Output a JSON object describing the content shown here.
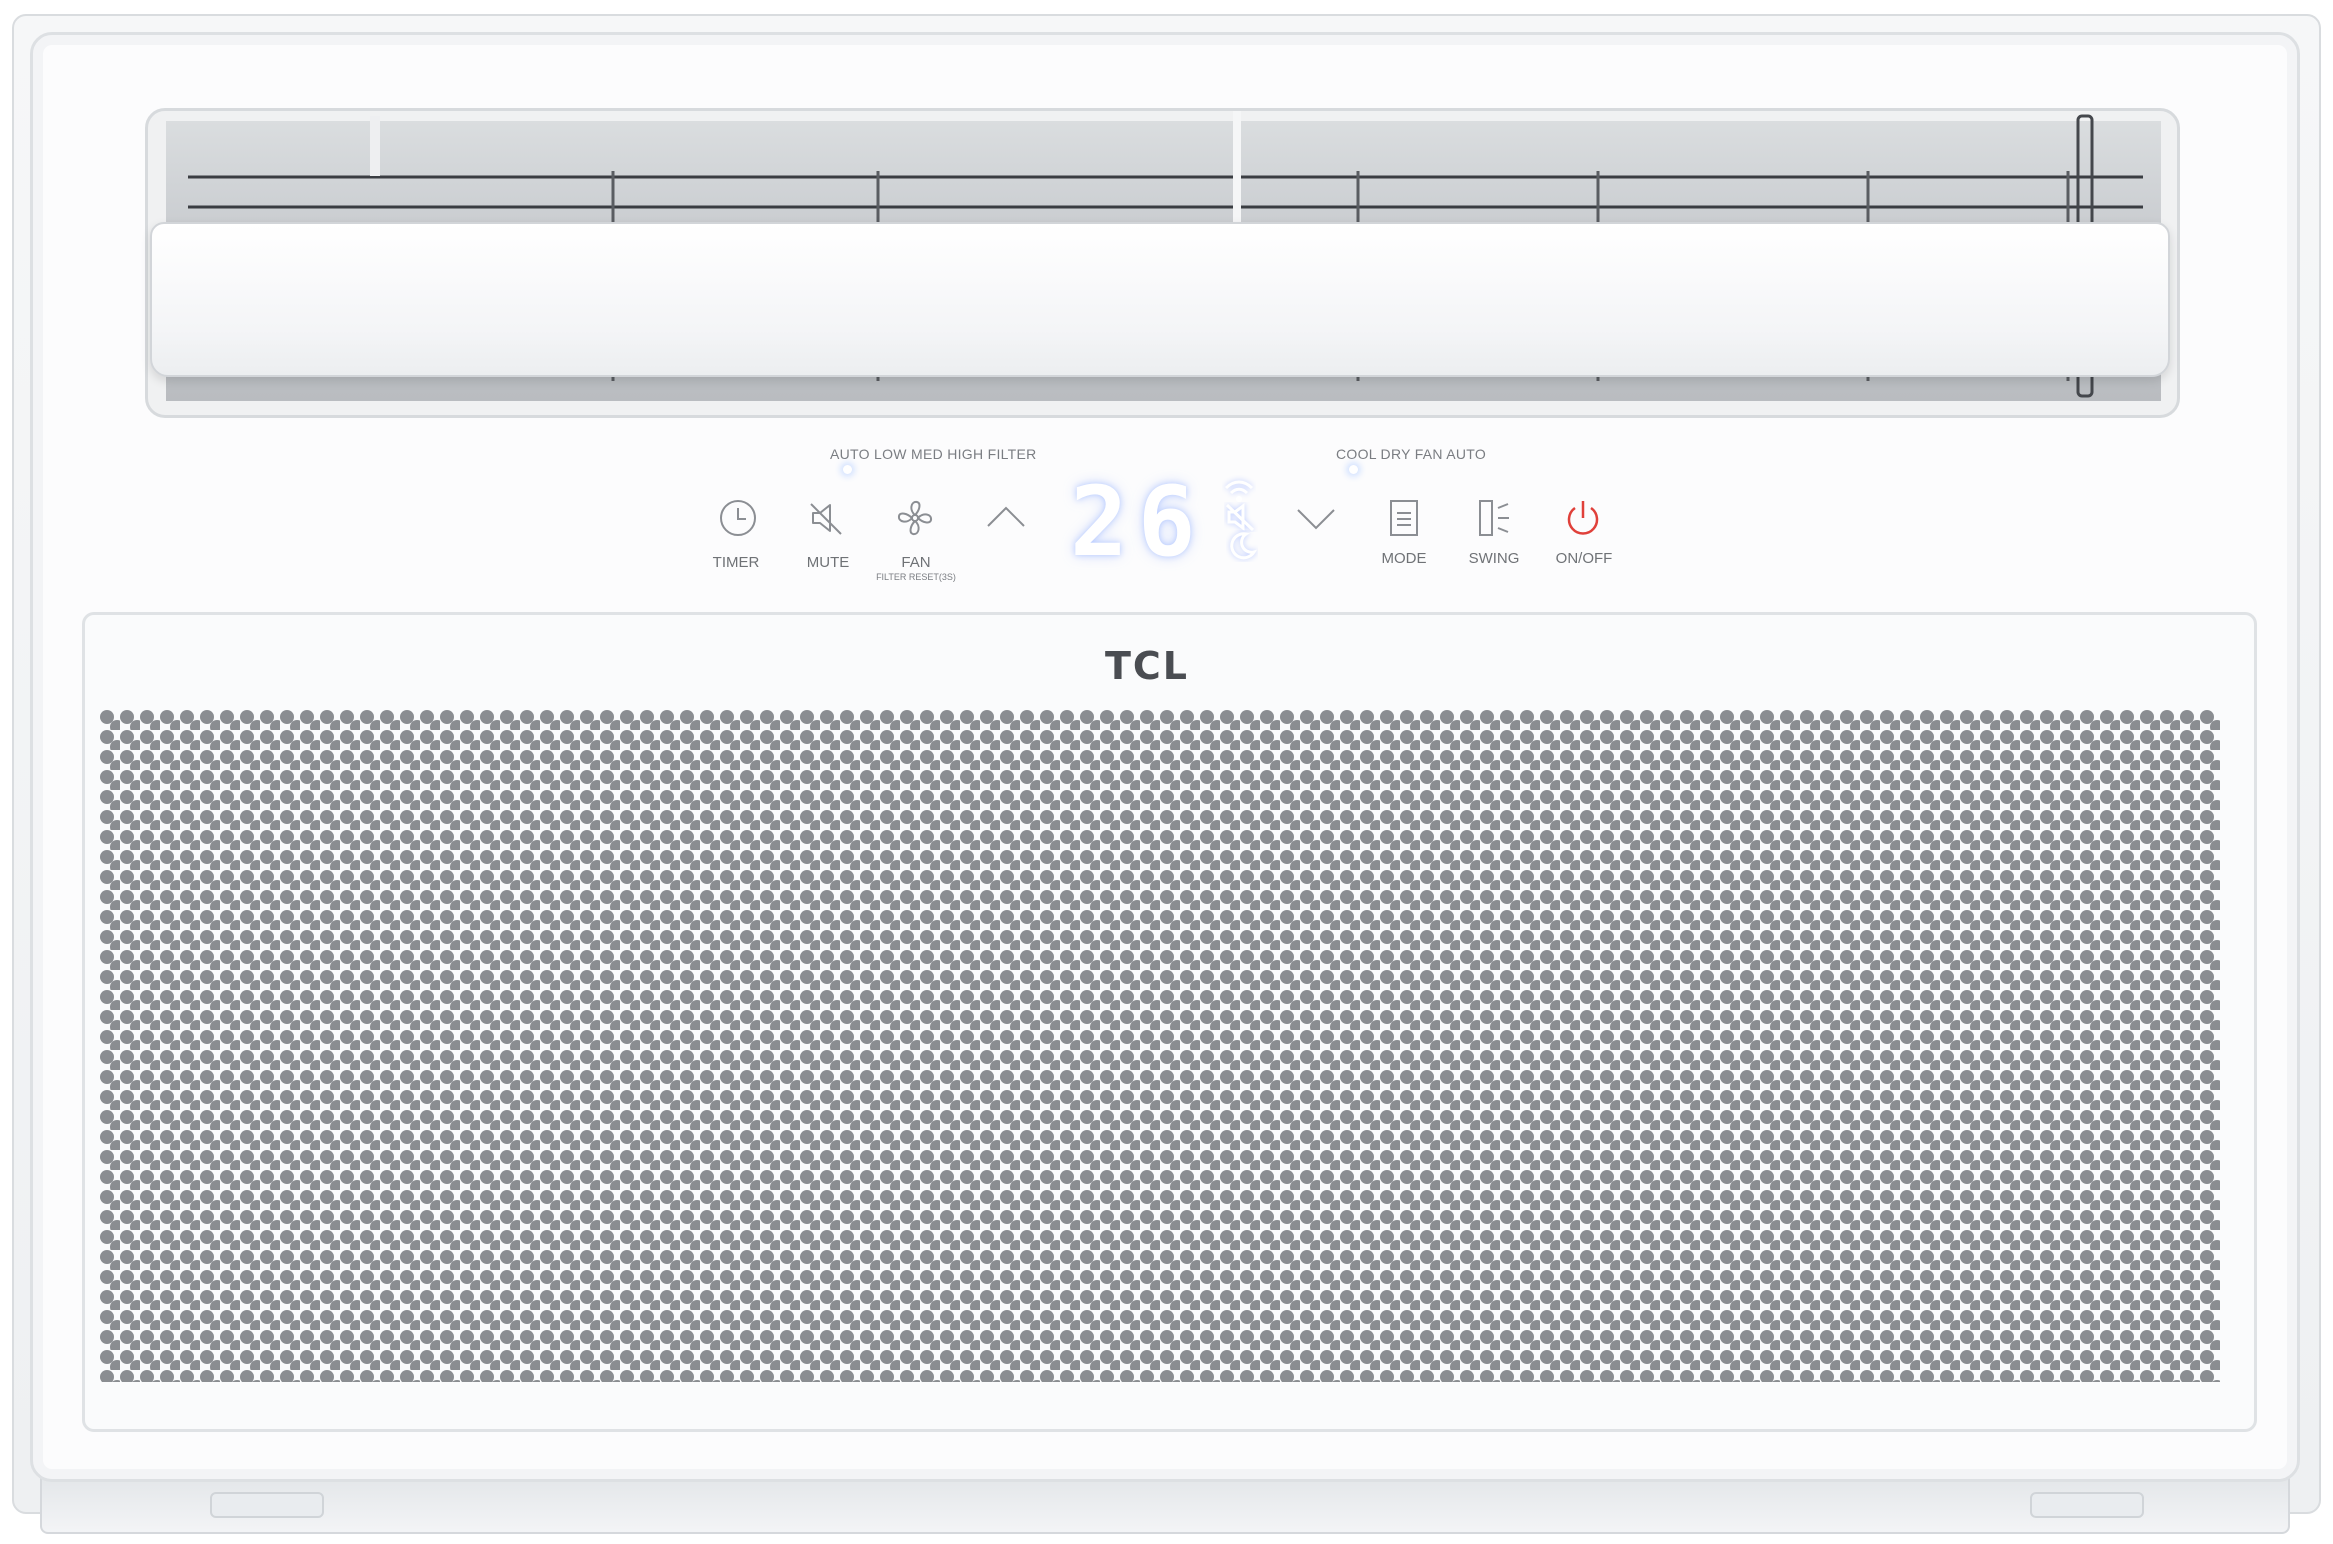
{
  "brand": {
    "logo_text": "TCL"
  },
  "fan_speed_indicators": {
    "labels": "AUTO  LOW  MED  HIGH  FILTER"
  },
  "mode_indicators": {
    "labels": "COOL  DRY  FAN  AUTO"
  },
  "display": {
    "temperature": "26"
  },
  "buttons": {
    "timer": "TIMER",
    "mute": "MUTE",
    "fan": "FAN",
    "fan_sub": "FILTER RESET(3S)",
    "mode": "MODE",
    "swing": "SWING",
    "power": "ON/OFF"
  },
  "icons": {
    "timer": "clock-icon",
    "mute": "speaker-mute-icon",
    "fan": "fan-icon",
    "up": "chevron-up-icon",
    "down": "chevron-down-icon",
    "wifi": "wifi-icon",
    "sleep": "moon-icon",
    "mode": "document-icon",
    "swing": "swing-icon",
    "power": "power-icon"
  },
  "colors": {
    "power_accent": "#e0403a",
    "grille_dot": "#8a8d91",
    "icon_gray": "#8b8e93"
  }
}
